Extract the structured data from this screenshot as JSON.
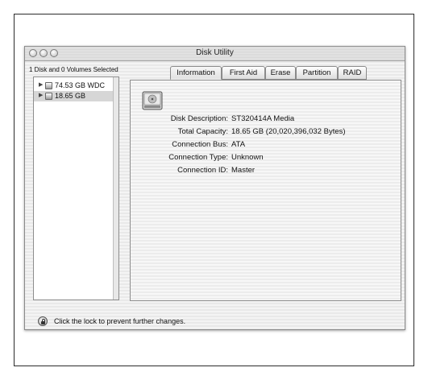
{
  "window": {
    "title": "Disk Utility"
  },
  "sidebar": {
    "selection_summary": "1 Disk and 0 Volumes Selected",
    "drives": [
      {
        "label": "74.53 GB WDC",
        "selected": false
      },
      {
        "label": "18.65 GB",
        "selected": true
      }
    ]
  },
  "tabs": [
    {
      "label": "Information",
      "active": true
    },
    {
      "label": "First Aid",
      "active": false
    },
    {
      "label": "Erase",
      "active": false
    },
    {
      "label": "Partition",
      "active": false
    },
    {
      "label": "RAID",
      "active": false
    }
  ],
  "info": {
    "rows": [
      {
        "key": "Disk Description:",
        "value": "ST320414A Media"
      },
      {
        "key": "Total Capacity:",
        "value": "18.65 GB (20,020,396,032 Bytes)"
      },
      {
        "key": "Connection Bus:",
        "value": "ATA"
      },
      {
        "key": "Connection Type:",
        "value": "Unknown"
      },
      {
        "key": "Connection ID:",
        "value": "Master"
      }
    ]
  },
  "footer": {
    "lock_text": "Click the lock to prevent further changes."
  },
  "icons": {
    "window_buttons": [
      "close-button-icon",
      "minimize-button-icon",
      "zoom-button-icon"
    ],
    "drive": "hard-disk-icon",
    "lock": "lock-icon"
  }
}
